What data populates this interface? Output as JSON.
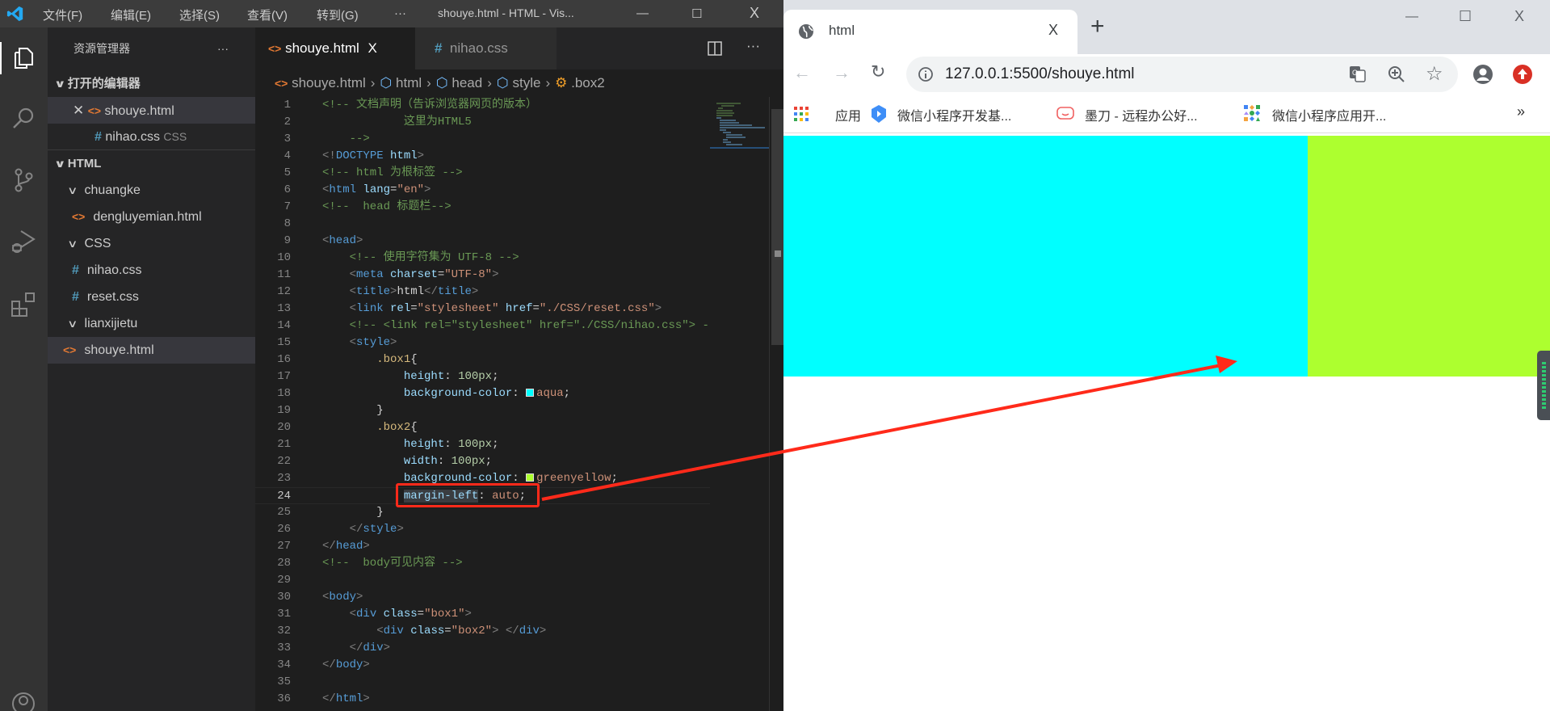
{
  "vscode": {
    "menu": [
      "文件(F)",
      "编辑(E)",
      "选择(S)",
      "查看(V)",
      "转到(G)"
    ],
    "more": "···",
    "window_title": "shouye.html - HTML - Vis...",
    "window_controls": {
      "minimize": "—",
      "maximize": "☐",
      "close": "X"
    },
    "sidebar": {
      "title": "资源管理器",
      "more": "···",
      "open_editors_label": "打开的编辑器",
      "open_editors": [
        {
          "name": "shouye.html",
          "type": "html",
          "selected": true
        },
        {
          "name": "nihao.css",
          "type": "css",
          "detail": "CSS"
        }
      ],
      "folder_label": "HTML",
      "tree": [
        {
          "name": "chuangke",
          "type": "folder",
          "depth": 1
        },
        {
          "name": "dengluyemian.html",
          "type": "html",
          "depth": 2
        },
        {
          "name": "CSS",
          "type": "folder",
          "depth": 1
        },
        {
          "name": "nihao.css",
          "type": "css",
          "depth": 2
        },
        {
          "name": "reset.css",
          "type": "css",
          "depth": 2
        },
        {
          "name": "lianxijietu",
          "type": "folder",
          "depth": 1
        },
        {
          "name": "shouye.html",
          "type": "html",
          "depth": 2,
          "selected": true
        }
      ]
    },
    "tabs": [
      {
        "label": "shouye.html",
        "type": "html",
        "active": true,
        "close": "X"
      },
      {
        "label": "nihao.css",
        "type": "css",
        "active": false
      }
    ],
    "breadcrumb": [
      "shouye.html",
      "html",
      "head",
      "style",
      ".box2"
    ],
    "code": [
      [
        [
          "c",
          "<!-- 文档声明（告诉浏览器网页的版本）"
        ]
      ],
      [
        [
          "c",
          "            这里为HTML5"
        ]
      ],
      [
        [
          "c",
          "    -->"
        ]
      ],
      [
        [
          "p",
          "<!"
        ],
        [
          "t",
          "DOCTYPE"
        ],
        [
          "x",
          " "
        ],
        [
          "a",
          "html"
        ],
        [
          "p",
          ">"
        ]
      ],
      [
        [
          "c",
          "<!-- html 为根标签 -->"
        ]
      ],
      [
        [
          "p",
          "<"
        ],
        [
          "t",
          "html"
        ],
        [
          "x",
          " "
        ],
        [
          "a",
          "lang"
        ],
        [
          "x",
          "="
        ],
        [
          "s",
          "\"en\""
        ],
        [
          "p",
          ">"
        ]
      ],
      [
        [
          "c",
          "<!--  head 标题栏-->"
        ]
      ],
      [],
      [
        [
          "p",
          "<"
        ],
        [
          "t",
          "head"
        ],
        [
          "p",
          ">"
        ]
      ],
      [
        [
          "x",
          "    "
        ],
        [
          "c",
          "<!-- 使用字符集为 UTF-8 -->"
        ]
      ],
      [
        [
          "x",
          "    "
        ],
        [
          "p",
          "<"
        ],
        [
          "t",
          "meta"
        ],
        [
          "x",
          " "
        ],
        [
          "a",
          "charset"
        ],
        [
          "x",
          "="
        ],
        [
          "s",
          "\"UTF-8\""
        ],
        [
          "p",
          ">"
        ]
      ],
      [
        [
          "x",
          "    "
        ],
        [
          "p",
          "<"
        ],
        [
          "t",
          "title"
        ],
        [
          "p",
          ">"
        ],
        [
          "x",
          "html"
        ],
        [
          "p",
          "</"
        ],
        [
          "t",
          "title"
        ],
        [
          "p",
          ">"
        ]
      ],
      [
        [
          "x",
          "    "
        ],
        [
          "p",
          "<"
        ],
        [
          "t",
          "link"
        ],
        [
          "x",
          " "
        ],
        [
          "a",
          "rel"
        ],
        [
          "x",
          "="
        ],
        [
          "s",
          "\"stylesheet\""
        ],
        [
          "x",
          " "
        ],
        [
          "a",
          "href"
        ],
        [
          "x",
          "="
        ],
        [
          "s",
          "\"./CSS/reset.css\""
        ],
        [
          "p",
          ">"
        ]
      ],
      [
        [
          "x",
          "    "
        ],
        [
          "c",
          "<!-- <link rel=\"stylesheet\" href=\"./CSS/nihao.css\"> -->"
        ]
      ],
      [
        [
          "x",
          "    "
        ],
        [
          "p",
          "<"
        ],
        [
          "t",
          "style"
        ],
        [
          "p",
          ">"
        ]
      ],
      [
        [
          "x",
          "        "
        ],
        [
          "sel",
          ".box1"
        ],
        [
          "x",
          "{"
        ]
      ],
      [
        [
          "x",
          "            "
        ],
        [
          "a",
          "height"
        ],
        [
          "x",
          ": "
        ],
        [
          "v",
          "100px"
        ],
        [
          "x",
          ";"
        ]
      ],
      [
        [
          "x",
          "            "
        ],
        [
          "a",
          "background-color"
        ],
        [
          "x",
          ": "
        ],
        [
          "sw",
          "#00ffff"
        ],
        [
          "k",
          "aqua"
        ],
        [
          "x",
          ";"
        ]
      ],
      [
        [
          "x",
          "        }"
        ]
      ],
      [
        [
          "x",
          "        "
        ],
        [
          "sel",
          ".box2"
        ],
        [
          "x",
          "{"
        ]
      ],
      [
        [
          "x",
          "            "
        ],
        [
          "a",
          "height"
        ],
        [
          "x",
          ": "
        ],
        [
          "v",
          "100px"
        ],
        [
          "x",
          ";"
        ]
      ],
      [
        [
          "x",
          "            "
        ],
        [
          "a",
          "width"
        ],
        [
          "x",
          ": "
        ],
        [
          "v",
          "100px"
        ],
        [
          "x",
          ";"
        ]
      ],
      [
        [
          "x",
          "            "
        ],
        [
          "a",
          "background-color"
        ],
        [
          "x",
          ": "
        ],
        [
          "sw",
          "#adff2f"
        ],
        [
          "k",
          "greenyellow"
        ],
        [
          "x",
          ";"
        ]
      ],
      [
        [
          "x",
          "            "
        ],
        [
          "hl",
          "margin-left"
        ],
        [
          "x",
          ": "
        ],
        [
          "k",
          "auto"
        ],
        [
          "x",
          ";"
        ]
      ],
      [
        [
          "x",
          "        }"
        ]
      ],
      [
        [
          "x",
          "    "
        ],
        [
          "p",
          "</"
        ],
        [
          "t",
          "style"
        ],
        [
          "p",
          ">"
        ]
      ],
      [
        [
          "p",
          "</"
        ],
        [
          "t",
          "head"
        ],
        [
          "p",
          ">"
        ]
      ],
      [
        [
          "c",
          "<!--  body可见内容 -->"
        ]
      ],
      [],
      [
        [
          "p",
          "<"
        ],
        [
          "t",
          "body"
        ],
        [
          "p",
          ">"
        ]
      ],
      [
        [
          "x",
          "    "
        ],
        [
          "p",
          "<"
        ],
        [
          "t",
          "div"
        ],
        [
          "x",
          " "
        ],
        [
          "a",
          "class"
        ],
        [
          "x",
          "="
        ],
        [
          "s",
          "\"box1\""
        ],
        [
          "p",
          ">"
        ]
      ],
      [
        [
          "x",
          "        "
        ],
        [
          "p",
          "<"
        ],
        [
          "t",
          "div"
        ],
        [
          "x",
          " "
        ],
        [
          "a",
          "class"
        ],
        [
          "x",
          "="
        ],
        [
          "s",
          "\"box2\""
        ],
        [
          "p",
          "> </"
        ],
        [
          "t",
          "div"
        ],
        [
          "p",
          ">"
        ]
      ],
      [
        [
          "x",
          "    "
        ],
        [
          "p",
          "</"
        ],
        [
          "t",
          "div"
        ],
        [
          "p",
          ">"
        ]
      ],
      [
        [
          "p",
          "</"
        ],
        [
          "t",
          "body"
        ],
        [
          "p",
          ">"
        ]
      ],
      [],
      [
        [
          "p",
          "</"
        ],
        [
          "t",
          "html"
        ],
        [
          "p",
          ">"
        ]
      ]
    ],
    "current_line": 24
  },
  "browser": {
    "tab_title": "html",
    "tab_close": "X",
    "new_tab": "+",
    "url": "127.0.0.1:5500/shouye.html",
    "window_controls": {
      "minimize": "—",
      "maximize": "☐",
      "close": "X"
    },
    "bookmarks": [
      {
        "label": "应用",
        "icon": "apps-grid-icon"
      },
      {
        "label": "微信小程序开发基...",
        "icon": "wechat-devtools-icon"
      },
      {
        "label": "墨刀 - 远程办公好...",
        "icon": "modao-icon"
      },
      {
        "label": "微信小程序应用开...",
        "icon": "shapes-icon"
      }
    ],
    "bookmarks_more": "»",
    "page": {
      "box1_color": "#00ffff",
      "box2_color": "#adff2f"
    }
  },
  "annotation": {
    "color": "#ff2a1a"
  }
}
